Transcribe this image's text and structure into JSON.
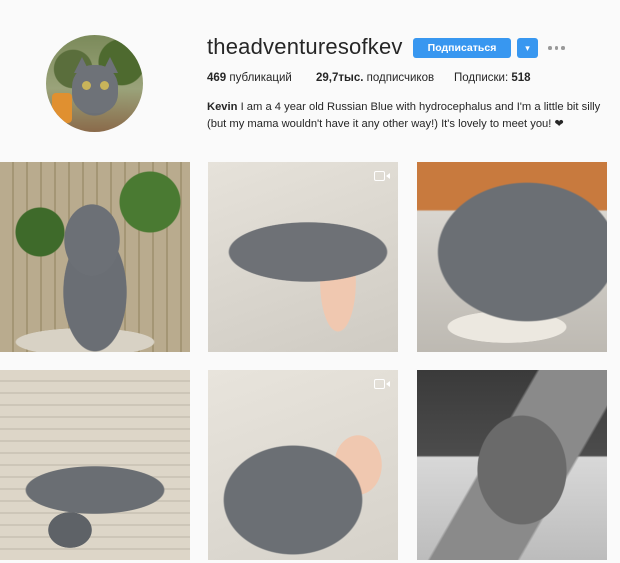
{
  "profile": {
    "username": "theadventuresofkev",
    "follow_label": "Подписаться",
    "dropdown_label": "▾",
    "stats": {
      "posts": {
        "value": "469",
        "label": "публикаций"
      },
      "followers": {
        "value": "29,7тыс.",
        "label": "подписчиков"
      },
      "following": {
        "label": "Подписки:",
        "value": "518"
      }
    },
    "bio": {
      "name": "Kevin",
      "text": "I am a 4 year old Russian Blue with hydrocephalus and I'm a little bit silly (but my mama wouldn't have it any other way!) It's lovely to meet you! ❤"
    }
  },
  "colors": {
    "accent": "#3897f0",
    "background": "#fafafa",
    "text": "#262626"
  },
  "icons": {
    "more": "more-horizontal-icon",
    "video": "video-camera-icon"
  },
  "posts": [
    {
      "kind": "photo"
    },
    {
      "kind": "video"
    },
    {
      "kind": "photo"
    },
    {
      "kind": "photo"
    },
    {
      "kind": "video"
    },
    {
      "kind": "photo"
    }
  ]
}
